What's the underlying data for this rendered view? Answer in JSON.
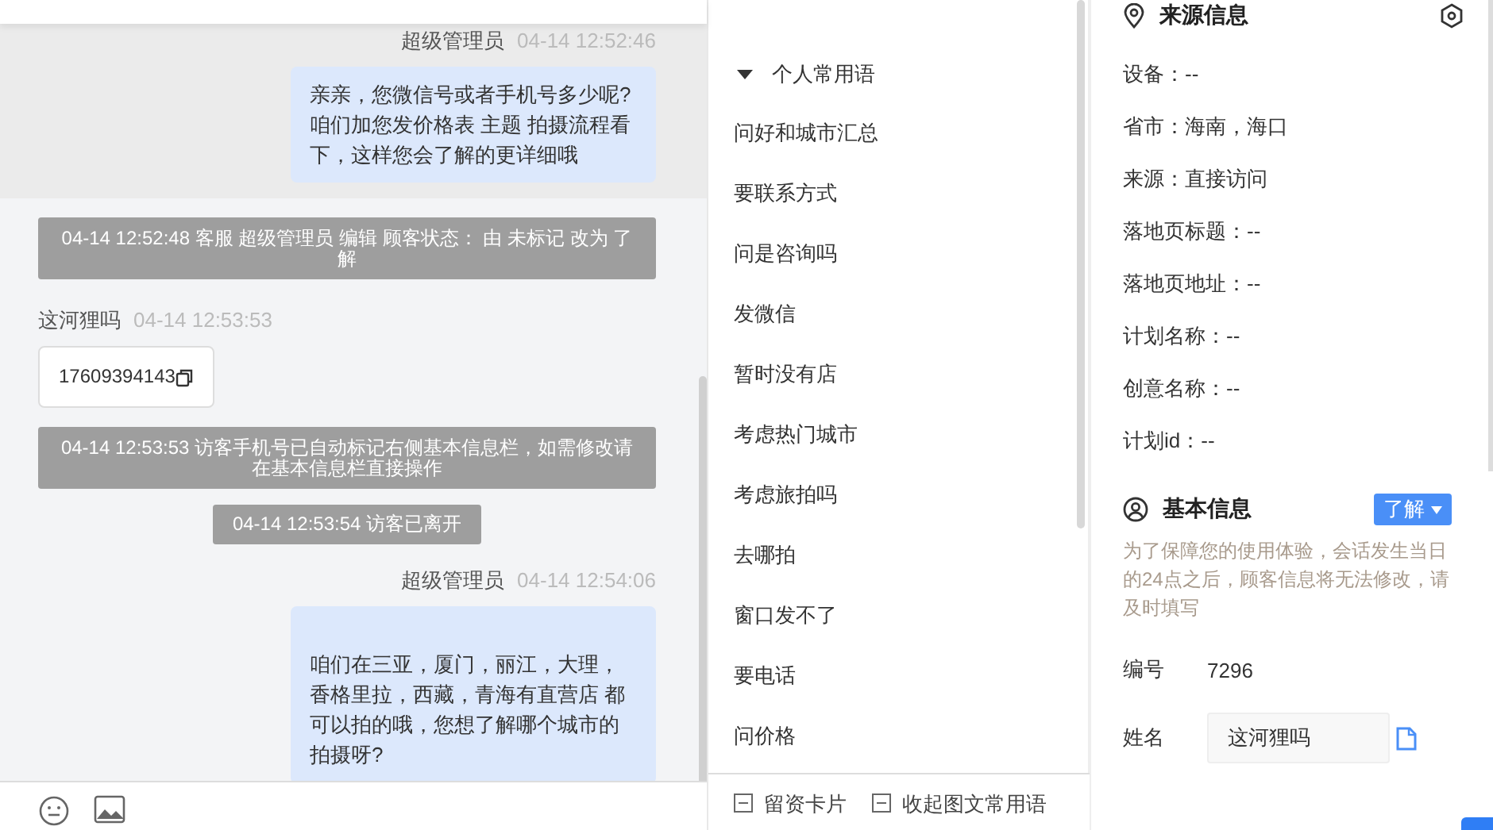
{
  "chat": {
    "messages": [
      {
        "kind": "agent",
        "sender": "超级管理员",
        "time": "04-14 12:52:46",
        "text": "亲亲，您微信号或者手机号多少呢?咱们加您发价格表 主题 拍摄流程看下，这样您会了解的更详细哦",
        "highlighted": true
      },
      {
        "kind": "system",
        "text": "04-14 12:52:48 客服 超级管理员 编辑 顾客状态： 由 未标记 改为 了解"
      },
      {
        "kind": "visitor",
        "sender": "这河狸吗",
        "time": "04-14 12:53:53",
        "text": "17609394143"
      },
      {
        "kind": "system",
        "text": "04-14 12:53:53 访客手机号已自动标记右侧基本信息栏，如需修改请在基本信息栏直接操作"
      },
      {
        "kind": "system",
        "text": "04-14 12:53:54 访客已离开"
      },
      {
        "kind": "agent",
        "sender": "超级管理员",
        "time": "04-14 12:54:06",
        "text": "\n咱们在三亚，厦门，丽江，大理，香格里拉，西藏，青海有直营店 都可以拍的哦，您想了解哪个城市的拍摄呀?",
        "highlighted": false
      }
    ]
  },
  "phrases": {
    "group": {
      "label": "个人常用语",
      "expanded": true
    },
    "items": [
      "问好和城市汇总",
      "要联系方式",
      "问是咨询吗",
      "发微信",
      "暂时没有店",
      "考虑热门城市",
      "考虑旅拍吗",
      "去哪拍",
      "窗口发不了",
      "要电话",
      "问价格"
    ]
  },
  "bottom_bar": {
    "options": [
      "留资卡片",
      "收起图文常用语"
    ]
  },
  "source_info": {
    "title": "来源信息",
    "rows": [
      "设备：--",
      "省市：海南，海口",
      "来源：直接访问",
      "落地页标题：--",
      "落地页地址：--",
      "计划名称：--",
      "创意名称：--",
      "计划id：--"
    ]
  },
  "basic_info": {
    "title": "基本信息",
    "status": "了解",
    "note": "为了保障您的使用体验，会话发生当日的24点之后，顾客信息将无法修改，请及时填写",
    "fields": [
      {
        "kind": "text",
        "label": "编号",
        "value": "7296"
      },
      {
        "kind": "input",
        "label": "姓名",
        "value": "这河狸吗"
      }
    ]
  }
}
